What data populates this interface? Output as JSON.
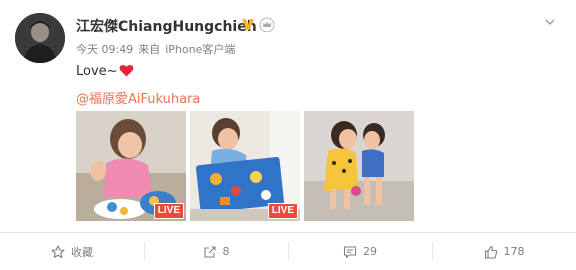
{
  "post": {
    "username": "江宏傑ChiangHungchieh",
    "time": "今天 09:49",
    "source_prefix": "来自",
    "source": "iPhone客户端",
    "text": "Love~",
    "mention": "@福原愛AiFukuhara",
    "photos": [
      {
        "live_label": "LIVE"
      },
      {
        "live_label": "LIVE"
      },
      {
        "live_label": ""
      }
    ]
  },
  "actions": {
    "favorite_label": "收藏",
    "repost_count": "8",
    "comment_count": "29",
    "like_count": "178"
  },
  "colors": {
    "mention": "#eb7350",
    "verified_badge": "#f5b619",
    "live_badge": "#f04b3a",
    "heart": "#e6243d"
  }
}
